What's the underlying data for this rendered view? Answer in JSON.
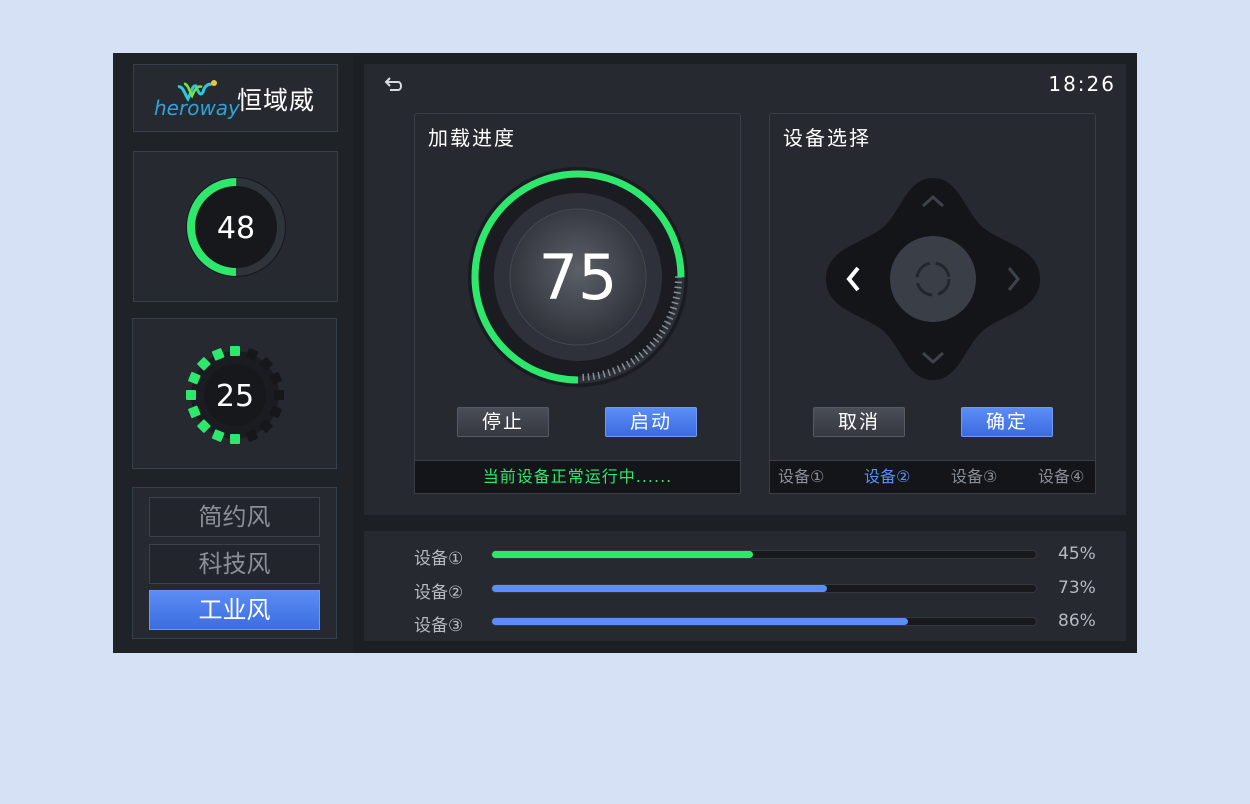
{
  "brand": {
    "name": "恒域威",
    "logo_text": "heroway"
  },
  "gauges": [
    {
      "value": "48",
      "fraction": 0.5
    },
    {
      "value": "25",
      "fraction": 0.5
    }
  ],
  "styles": [
    {
      "label": "简约风",
      "active": false
    },
    {
      "label": "科技风",
      "active": false
    },
    {
      "label": "工业风",
      "active": true
    }
  ],
  "header": {
    "time": "18:26"
  },
  "load_panel": {
    "title": "加载进度",
    "value": "75",
    "stop_label": "停止",
    "start_label": "启动",
    "status": "当前设备正常运行中......"
  },
  "device_panel": {
    "title": "设备选择",
    "cancel_label": "取消",
    "confirm_label": "确定",
    "tabs": [
      "设备①",
      "设备②",
      "设备③",
      "设备④"
    ],
    "active_tab": 1
  },
  "progress": [
    {
      "label": "设备①",
      "percent": "45%",
      "fraction": 0.48,
      "color": "#2ee86e"
    },
    {
      "label": "设备②",
      "percent": "73%",
      "fraction": 0.615,
      "color": "#5b8ef6"
    },
    {
      "label": "设备③",
      "percent": "86%",
      "fraction": 0.765,
      "color": "#5b8ef6"
    }
  ],
  "colors": {
    "accent_green": "#2ee86e",
    "accent_blue": "#5b8ef6",
    "panel": "#262930"
  }
}
